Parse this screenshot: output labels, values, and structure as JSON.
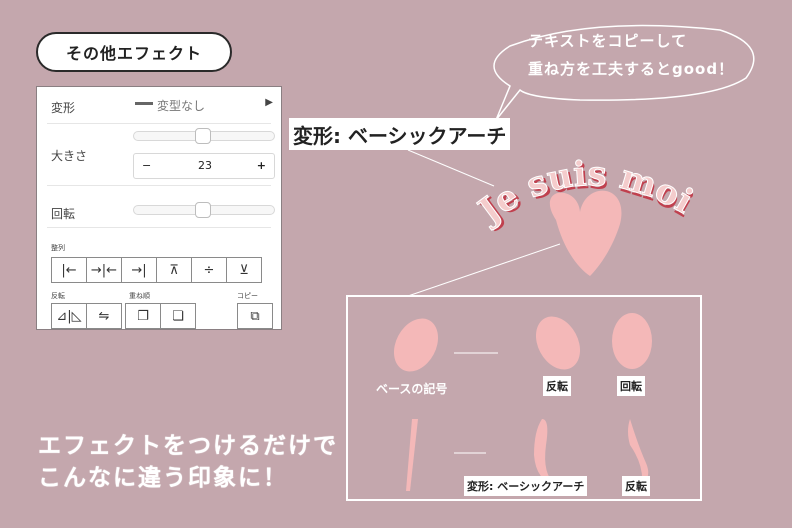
{
  "title_pill": "その他エフェクト",
  "panel": {
    "deform_label": "変形",
    "deform_value": "変型なし",
    "size_label": "大きさ",
    "size_value": "23",
    "minus": "−",
    "plus": "+",
    "rotate_label": "回転",
    "align_label": "整列",
    "flip_label": "反転",
    "order_label": "重ね順",
    "copy_label": "コピー"
  },
  "headline": "変形: ベーシックアーチ",
  "bubble": {
    "line1": "テキストをコピーして",
    "line2": "重ね方を工夫するとgood！"
  },
  "arch_text": "Je suis moi",
  "frame": {
    "base_label": "ベースの記号",
    "flip_tag_top": "反転",
    "rotate_tag": "回転",
    "arch_tag": "変形: ベーシックアーチ",
    "flip_tag_bottom": "反転"
  },
  "bottom": {
    "line1": "エフェクトをつけるだけで",
    "line2": "こんなに違う印象に！"
  },
  "colors": {
    "background": "#c4a7ad",
    "pink_shape": "#f4b8b8",
    "arch_text": "#f1c4c4",
    "arch_shadow": "#c0404e"
  }
}
